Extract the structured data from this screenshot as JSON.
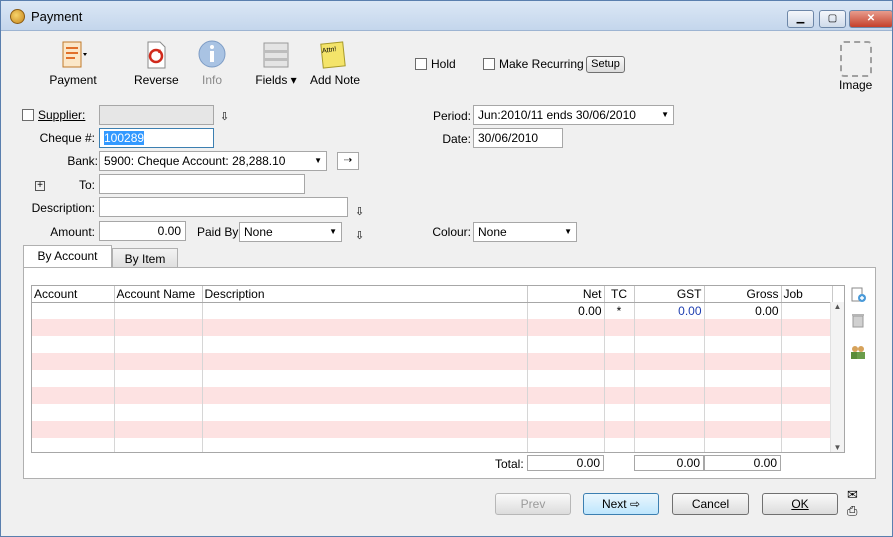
{
  "window": {
    "title": "Payment",
    "min": "▁",
    "max": "▢",
    "close": "✕"
  },
  "toolbar": {
    "payment": "Payment",
    "reverse": "Reverse",
    "info": "Info",
    "fields": "Fields",
    "add_note": "Add Note",
    "note_text": "Attn!",
    "hold": "Hold",
    "make_recurring": "Make Recurring",
    "setup": "Setup",
    "image": "Image"
  },
  "form": {
    "supplier_label": "Supplier:",
    "supplier_value": "",
    "cheque_label": "Cheque #:",
    "cheque_value": "100289",
    "bank_label": "Bank:",
    "bank_value": "5900: Cheque Account: 28,288.10",
    "to_label": "To:",
    "to_value": "",
    "description_label": "Description:",
    "description_value": "",
    "amount_label": "Amount:",
    "amount_value": "0.00",
    "paid_by_label": "Paid By:",
    "paid_by_value": "None",
    "period_label": "Period:",
    "period_value": "Jun:2010/11 ends 30/06/2010",
    "date_label": "Date:",
    "date_value": "30/06/2010",
    "colour_label": "Colour:",
    "colour_value": "None",
    "expand": "+"
  },
  "tabs": [
    "By Account",
    "By Item"
  ],
  "grid": {
    "columns": [
      "Account",
      "Account Name",
      "Description",
      "Net",
      "TC",
      "GST",
      "Gross",
      "Job"
    ],
    "rows": [
      {
        "account": "",
        "name": "",
        "description": "",
        "net": "0.00",
        "tc": "*",
        "gst": "0.00",
        "gross": "0.00",
        "job": ""
      }
    ],
    "total_label": "Total:",
    "totals": {
      "net": "0.00",
      "gst": "0.00",
      "gross": "0.00"
    }
  },
  "buttons": {
    "prev": "Prev",
    "next": "Next",
    "cancel": "Cancel",
    "ok": "OK"
  },
  "colors": {
    "row_stripe": "#fde2e2",
    "selection": "#3399ff",
    "gst_text": "#1f3fb0"
  }
}
